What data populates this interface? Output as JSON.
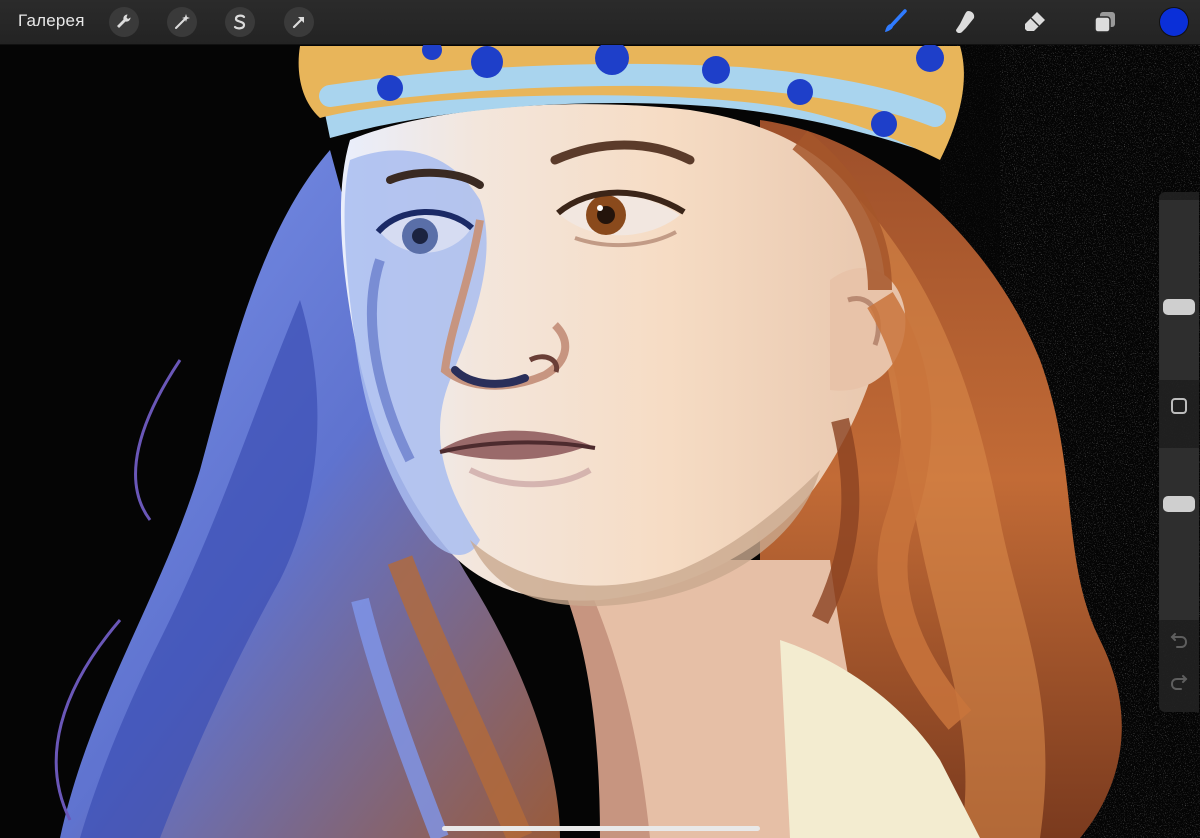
{
  "toolbar": {
    "gallery_label": "Галерея",
    "left_tools": [
      "wrench-icon",
      "magic-wand-icon",
      "selection-s-icon",
      "transform-arrow-icon"
    ],
    "right_tools": [
      "brush-icon",
      "smudge-icon",
      "eraser-icon",
      "layers-icon"
    ],
    "active_tool": "brush-icon",
    "active_color": "#0a2fd8"
  },
  "sidebar": {
    "brush_size_level": 0.55,
    "opacity_level": 0.4,
    "controls": [
      "brush-size-slider",
      "modify-button",
      "opacity-slider",
      "undo-icon",
      "redo-icon"
    ]
  },
  "canvas": {
    "palette": {
      "crown": "#e8b55a",
      "crown_band": "#a9d4ee",
      "jewels": "#1e3fc9",
      "skin_light": "#f4dcc6",
      "skin_shadow": "#c9a98f",
      "cool_shadow": "#8ea7e6",
      "hair_warm": "#b0602d",
      "hair_cool": "#6f86e0",
      "collar": "#f3ecd0",
      "background": "#050505"
    }
  }
}
